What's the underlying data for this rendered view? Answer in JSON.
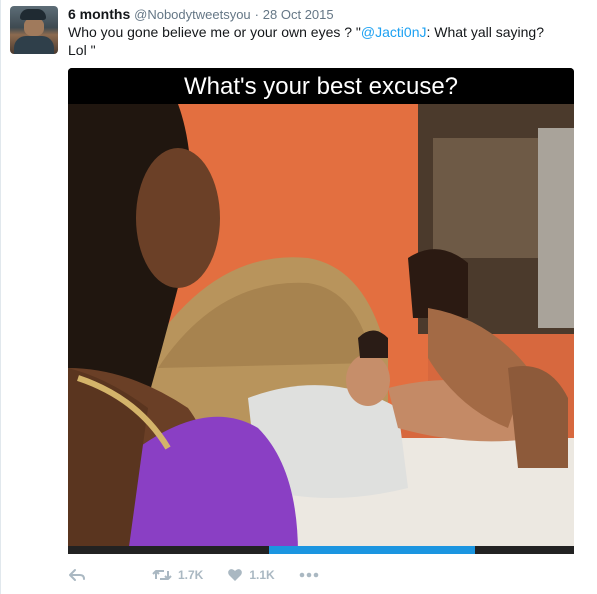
{
  "tweet": {
    "time_ago": "6 months",
    "handle": "@Nobodytweetsyou",
    "separator": "·",
    "date": "28 Oct 2015",
    "text_line1_before": "Who you gone believe me or your own eyes ?  \"",
    "mention": "@Jacti0nJ",
    "text_line1_after": ": What yall saying?",
    "text_line2": "Lol \""
  },
  "media": {
    "caption": "What's your best excuse?",
    "progress_fraction": 0.407
  },
  "actions": {
    "reply_icon": "reply-icon",
    "retweet_icon": "retweet-icon",
    "retweet_count": "1.7K",
    "like_icon": "heart-icon",
    "like_count": "1.1K",
    "more_icon": "more-icon"
  },
  "colors": {
    "accent": "#1da1f2",
    "muted": "#657786",
    "action_gray": "#aab8c2"
  }
}
